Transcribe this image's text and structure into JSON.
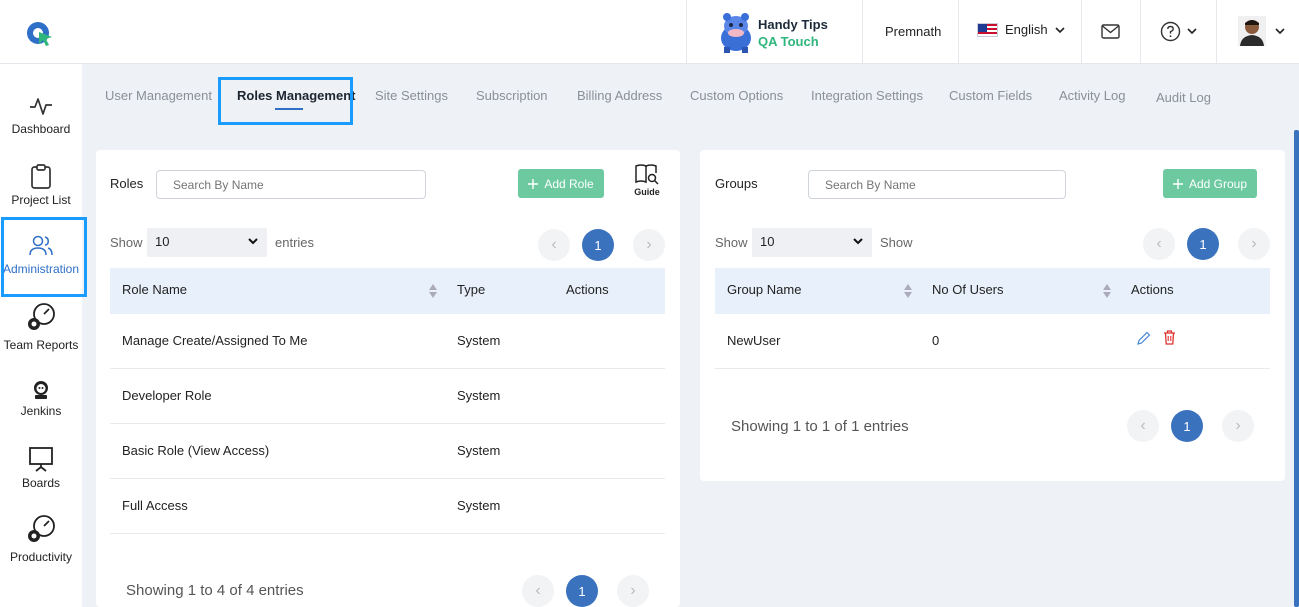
{
  "header": {
    "brand_line1": "Handy Tips",
    "brand_line2": "QA Touch",
    "user_name": "Premnath",
    "language": "English",
    "colors": {
      "accent": "#3a72bd",
      "green": "#2fb67c",
      "highlight": "#1a9bff"
    }
  },
  "sidebar": {
    "items": [
      {
        "label": "Dashboard",
        "icon": "activity-icon"
      },
      {
        "label": "Project List",
        "icon": "clipboard-icon"
      },
      {
        "label": "Administration",
        "icon": "users-icon",
        "active": true
      },
      {
        "label": "Team Reports",
        "icon": "gauge-icon"
      },
      {
        "label": "Jenkins",
        "icon": "jenkins-icon"
      },
      {
        "label": "Boards",
        "icon": "board-icon"
      },
      {
        "label": "Productivity",
        "icon": "gauge-icon"
      }
    ]
  },
  "tabs": [
    {
      "label": "User Management"
    },
    {
      "label": "Roles Management",
      "active": true
    },
    {
      "label": "Site Settings"
    },
    {
      "label": "Subscription"
    },
    {
      "label": "Billing Address"
    },
    {
      "label": "Custom Options"
    },
    {
      "label": "Integration Settings"
    },
    {
      "label": "Custom Fields"
    },
    {
      "label": "Activity Log"
    },
    {
      "label": "Audit Log"
    }
  ],
  "roles": {
    "label": "Roles",
    "search_placeholder": "Search By Name",
    "add_button": "Add Role",
    "guide_label": "Guide",
    "show_label": "Show",
    "entries_value": "10",
    "entries_label": "entries",
    "current_page": "1",
    "columns": [
      "Role Name",
      "Type",
      "Actions"
    ],
    "rows": [
      {
        "name": "Manage Create/Assigned To Me",
        "type": "System"
      },
      {
        "name": "Developer Role",
        "type": "System"
      },
      {
        "name": "Basic Role (View Access)",
        "type": "System"
      },
      {
        "name": "Full Access",
        "type": "System"
      }
    ],
    "showing": "Showing 1 to 4 of 4 entries"
  },
  "groups": {
    "label": "Groups",
    "search_placeholder": "Search By Name",
    "add_button": "Add Group",
    "show_label": "Show",
    "entries_value": "10",
    "entries_label": "Show",
    "current_page": "1",
    "columns": [
      "Group Name",
      "No Of Users",
      "Actions"
    ],
    "rows": [
      {
        "name": "NewUser",
        "users": "0"
      }
    ],
    "showing": "Showing 1 to 1 of 1 entries"
  }
}
